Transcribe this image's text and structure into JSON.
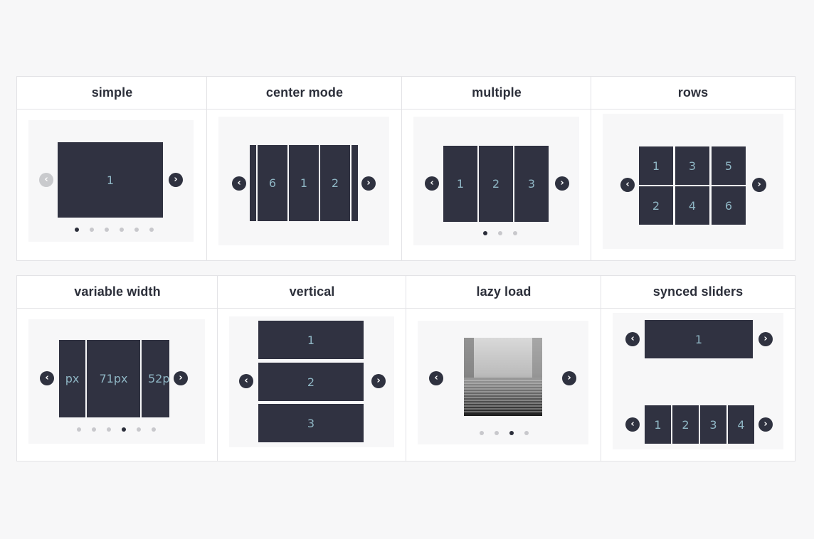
{
  "sections": {
    "simple": {
      "title": "simple",
      "slide": "1",
      "dots": 6,
      "active_dot": 0
    },
    "center_mode": {
      "title": "center mode",
      "slides": [
        "6",
        "1",
        "2"
      ]
    },
    "multiple": {
      "title": "multiple",
      "slides": [
        "1",
        "2",
        "3"
      ],
      "dots": 3,
      "active_dot": 0
    },
    "rows": {
      "title": "rows",
      "slides": [
        "1",
        "3",
        "5",
        "2",
        "4",
        "6"
      ]
    },
    "variable_width": {
      "title": "variable width",
      "slides": [
        "px",
        "71px",
        "52p"
      ],
      "dots": 6,
      "active_dot": 3
    },
    "vertical": {
      "title": "vertical",
      "slides": [
        "1",
        "2",
        "3"
      ]
    },
    "lazy_load": {
      "title": "lazy load",
      "dots": 4,
      "active_dot": 2
    },
    "synced_sliders": {
      "title": "synced sliders",
      "main_slide": "1",
      "thumbs": [
        "1",
        "2",
        "3",
        "4"
      ]
    }
  },
  "icons": {
    "prev": "chevron-left-icon",
    "next": "chevron-right-icon"
  },
  "colors": {
    "slide_bg": "#303241",
    "slide_text": "#8fb6c4",
    "arrow": "#2f3240",
    "arrow_disabled": "#c9cacd",
    "dot_active": "#2b2e3a",
    "dot_inactive": "#c8c8cc"
  }
}
